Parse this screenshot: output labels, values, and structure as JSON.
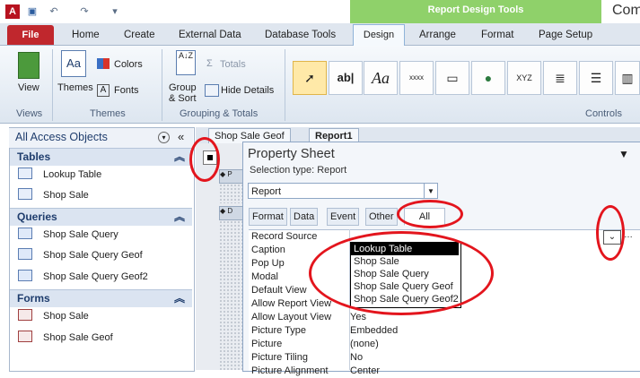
{
  "app": {
    "title": "Com",
    "context_band": "Report Design Tools"
  },
  "tabs": [
    {
      "label": "File"
    },
    {
      "label": "Home"
    },
    {
      "label": "Create"
    },
    {
      "label": "External Data"
    },
    {
      "label": "Database Tools"
    },
    {
      "label": "Design"
    },
    {
      "label": "Arrange"
    },
    {
      "label": "Format"
    },
    {
      "label": "Page Setup"
    }
  ],
  "ribbon": {
    "views": {
      "view_label": "View",
      "group": "Views"
    },
    "themes": {
      "themes_label": "Themes",
      "colors_label": "Colors",
      "fonts_label": "Fonts",
      "group": "Themes"
    },
    "grouping": {
      "group_sort_line1": "Group",
      "group_sort_line2": "& Sort",
      "totals_label": "Totals",
      "hide_details_label": "Hide Details",
      "group": "Grouping & Totals"
    },
    "controls": {
      "group": "Controls",
      "textbox_glyph": "ab|",
      "label_glyph": "Aa",
      "button_glyph": "xxxx",
      "xyz_glyph": "XYZ"
    }
  },
  "nav": {
    "header": "All Access Objects",
    "groups": [
      {
        "label": "Tables",
        "items": [
          "Lookup Table",
          "Shop Sale"
        ]
      },
      {
        "label": "Queries",
        "items": [
          "Shop Sale Query",
          "Shop Sale Query Geof",
          "Shop Sale Query Geof2"
        ]
      },
      {
        "label": "Forms",
        "items": [
          "Shop Sale",
          "Shop Sale Geof"
        ]
      }
    ]
  },
  "doc_tabs": [
    "Shop Sale Geof",
    "Report1"
  ],
  "property_sheet": {
    "title": "Property Sheet",
    "selection_type": "Selection type:  Report",
    "combo_value": "Report",
    "tabs": [
      "Format",
      "Data",
      "Event",
      "Other",
      "All"
    ],
    "rows": [
      {
        "name": "Record Source",
        "value": ""
      },
      {
        "name": "Caption",
        "value": ""
      },
      {
        "name": "Pop Up",
        "value": ""
      },
      {
        "name": "Modal",
        "value": ""
      },
      {
        "name": "Default View",
        "value": ""
      },
      {
        "name": "Allow Report View",
        "value": ""
      },
      {
        "name": "Allow Layout View",
        "value": "Yes"
      },
      {
        "name": "Picture Type",
        "value": "Embedded"
      },
      {
        "name": "Picture",
        "value": "(none)"
      },
      {
        "name": "Picture Tiling",
        "value": "No"
      },
      {
        "name": "Picture Alignment",
        "value": "Center"
      }
    ]
  },
  "dropdown": {
    "items": [
      "Lookup Table",
      "Shop Sale",
      "Shop Sale Query",
      "Shop Sale Query Geof",
      "Shop Sale Query Geof2"
    ],
    "selected_index": 0
  },
  "colors": {
    "file_tab": "#c0272d",
    "context_band": "#8fd16a",
    "annotation": "#e3151d"
  }
}
